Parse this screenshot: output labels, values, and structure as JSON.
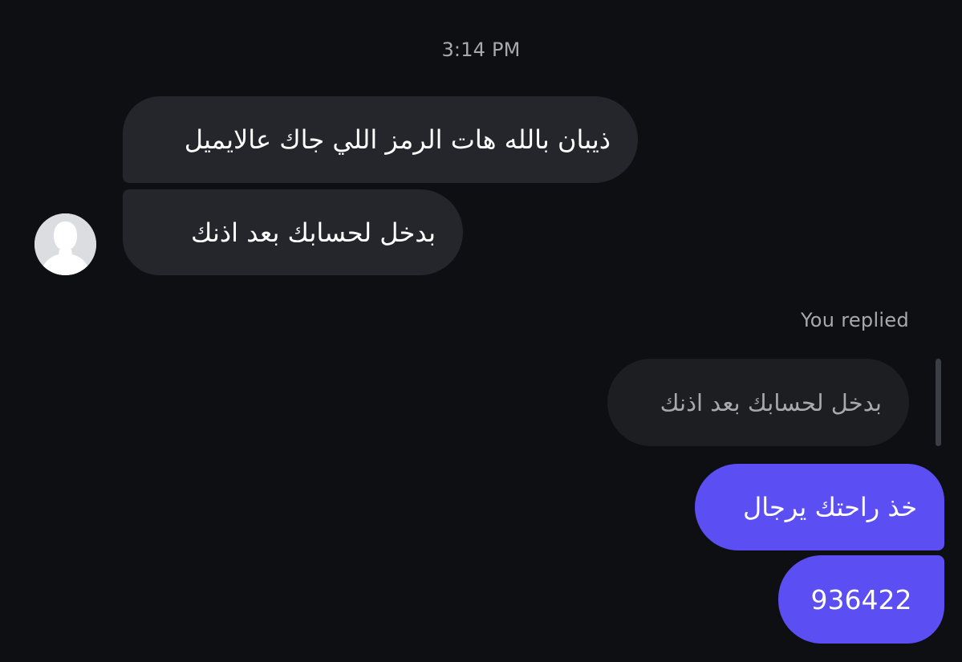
{
  "thread": {
    "timestamp": "3:14 PM",
    "incoming": [
      {
        "text": "ذيبان بالله هات الرمز اللي جاك عالايميل"
      },
      {
        "text": "بدخل لحسابك بعد اذنك"
      }
    ],
    "reply_label": "You replied",
    "quoted_message": "بدخل لحسابك بعد اذنك",
    "outgoing": [
      {
        "text": "خذ راحتك يرجال"
      },
      {
        "text": "936422"
      }
    ]
  },
  "colors": {
    "background": "#0d0f13",
    "incoming_bubble": "#24262b",
    "quoted_bubble": "#1c1e22",
    "outgoing_bubble": "#5b4ff4",
    "meta_text": "#a7a9ad"
  },
  "icons": {
    "avatar": "default-user-avatar-icon"
  }
}
